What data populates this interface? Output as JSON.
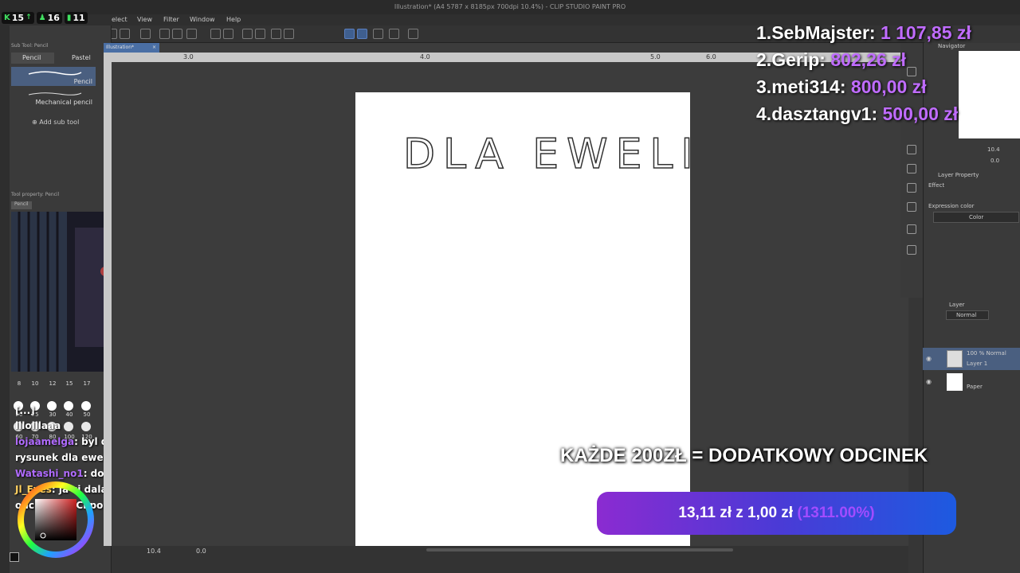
{
  "window": {
    "title": "Illustration* (A4 5787 x 8185px 700dpi 10.4%) - CLIP STUDIO PAINT PRO"
  },
  "stream_stats": [
    {
      "icon": "follower-icon",
      "value": "15"
    },
    {
      "icon": "user-icon",
      "value": "16"
    },
    {
      "icon": "chart-icon",
      "value": "11"
    }
  ],
  "menu": [
    "elect",
    "View",
    "Filter",
    "Window",
    "Help"
  ],
  "document_tab": "Illustration*",
  "ruler_labels": [
    "3.0",
    "4.0",
    "5.0",
    "6.0"
  ],
  "left_panel": {
    "subtool_header": "Sub Tool: Pencil",
    "tabs": [
      "Pencil",
      "Pastel"
    ],
    "brushes": [
      "Pencil",
      "Mechanical pencil"
    ],
    "add_sub_tool": "Add sub tool",
    "tool_property_header": "Tool property: Pencil",
    "tool_property_chip": "Pencil"
  },
  "brush_sizes": [
    "8",
    "10",
    "12",
    "15",
    "17",
    "20",
    "25",
    "30",
    "40",
    "50",
    "60",
    "70",
    "80",
    "100",
    "120"
  ],
  "chat": [
    {
      "user": "",
      "text": "[...]"
    },
    {
      "user": "lllolllaaa",
      "text": ""
    },
    {
      "user": "lojaamelga",
      "text": ": byl dzis obiecany"
    },
    {
      "user": "",
      "text": "rysunek dla eweliny"
    },
    {
      "user": "Watashi_no1",
      "text": ": dobra siema"
    },
    {
      "user": "Jl_Eves",
      "text": ": ja ci dalam pomysl na"
    },
    {
      "user": "",
      "text": "odcinek co Ci pomoge z nim xD"
    }
  ],
  "canvas": {
    "handwriting": "DLA EWELINY",
    "zoom": "10.4",
    "angle": "0.0"
  },
  "leaderboard": [
    {
      "rank": "1.",
      "name": "SebMajster:",
      "amount": "1 107,85 zł"
    },
    {
      "rank": "2.",
      "name": "Gerip:",
      "amount": "802,26 zł"
    },
    {
      "rank": "3.",
      "name": "meti314:",
      "amount": "800,00 zł"
    },
    {
      "rank": "4.",
      "name": "dasztangv1:",
      "amount": "500,00 zł"
    }
  ],
  "goal": {
    "headline": "KAŻDE 200ZŁ = DODATKOWY ODCINEK",
    "current": "13,11 zł",
    "separator": "z",
    "target": "1,00 zł",
    "percent": "(1311.00%)"
  },
  "right_panel": {
    "navigator": "Navigator",
    "nav_zoom": "10.4",
    "nav_angle": "0.0",
    "layer_property": "Layer Property",
    "effect": "Effect",
    "expression_color": "Expression color",
    "color": "Color",
    "layer_tab": "Layer",
    "blend_mode": "Normal",
    "layers": [
      {
        "line1": "100 % Normal",
        "line2": "Layer 1"
      },
      {
        "line1": "",
        "line2": "Paper"
      }
    ]
  },
  "colors": {
    "accent_purple": "#c06cff",
    "goal_start": "#8b2bd1",
    "goal_end": "#1d5ae0"
  }
}
